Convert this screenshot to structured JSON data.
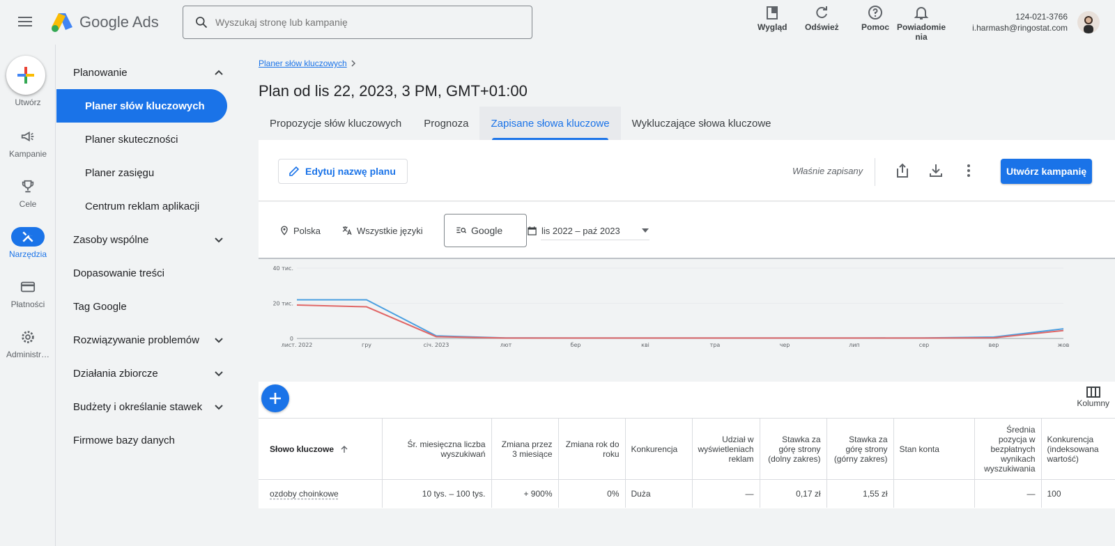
{
  "app": {
    "logo_google": "Google",
    "logo_ads": "Ads"
  },
  "search": {
    "placeholder": "Wyszukaj stronę lub kampanię"
  },
  "top_actions": {
    "appearance": "Wygląd",
    "refresh": "Odśwież",
    "help": "Pomoc",
    "notifications_line1": "Powiadomie",
    "notifications_line2": "nia"
  },
  "account": {
    "id": "124-021-3766",
    "email": "i.harmash@ringostat.com"
  },
  "rail": {
    "create": "Utwórz",
    "campaigns": "Kampanie",
    "goals": "Cele",
    "tools": "Narzędzia",
    "billing": "Płatności",
    "admin": "Administr…"
  },
  "sidebar": {
    "planning": "Planowanie",
    "keyword_planner": "Planer słów kluczowych",
    "performance_planner": "Planer skuteczności",
    "reach_planner": "Planer zasięgu",
    "app_ads_center": "Centrum reklam aplikacji",
    "shared_library": "Zasoby wspólne",
    "content_suitability": "Dopasowanie treści",
    "google_tag": "Tag Google",
    "troubleshooting": "Rozwiązywanie problemów",
    "bulk_actions": "Działania zbiorcze",
    "budgets_bidding": "Budżety i określanie stawek",
    "business_data": "Firmowe bazy danych"
  },
  "breadcrumb": "Planer słów kluczowych",
  "page_title": "Plan od lis 22, 2023, 3 PM, GMT+01:00",
  "tabs": {
    "ideas": "Propozycje słów kluczowych",
    "forecast": "Prognoza",
    "saved": "Zapisane słowa kluczowe",
    "negative": "Wykluczające słowa kluczowe"
  },
  "toolbar": {
    "edit_plan_name": "Edytuj nazwę planu",
    "saved_status": "Właśnie zapisany",
    "create_campaign": "Utwórz kampanię"
  },
  "filters": {
    "location": "Polska",
    "language": "Wszystkie języki",
    "network": "Google",
    "date_range": "lis 2022 – paź 2023"
  },
  "chart_data": {
    "type": "line",
    "x": [
      "лист. 2022",
      "гру",
      "січ. 2023",
      "лют",
      "бер",
      "кві",
      "тра",
      "чер",
      "лип",
      "сер",
      "вер",
      "жов"
    ],
    "yticks": [
      "0",
      "20 тис.",
      "40 тис."
    ],
    "ylim": [
      0,
      40000
    ],
    "series": [
      {
        "color": "#4a9fe0",
        "values": [
          22000,
          22000,
          1500,
          300,
          250,
          250,
          250,
          250,
          250,
          300,
          800,
          5500
        ]
      },
      {
        "color": "#e06666",
        "values": [
          19000,
          18000,
          1000,
          250,
          250,
          250,
          250,
          250,
          250,
          250,
          400,
          4500
        ]
      }
    ],
    "grid": true
  },
  "table": {
    "columns_label": "Kolumny",
    "headers": {
      "keyword": "Słowo kluczowe",
      "avg_searches": "Śr. miesięczna liczba wyszukiwań",
      "change_3m": "Zmiana przez 3 miesiące",
      "change_yoy": "Zmiana rok do roku",
      "competition": "Konkurencja",
      "impression_share": "Udział w wyświetleniach reklam",
      "bid_low": "Stawka za górę strony (dolny zakres)",
      "bid_high": "Stawka za górę strony (górny zakres)",
      "account_status": "Stan konta",
      "organic_position": "Średnia pozycja w bezpłatnych wynikach wyszukiwania",
      "competition_index": "Konkurencja (indeksowana wartość)"
    },
    "rows": [
      {
        "keyword": "ozdoby choinkowe",
        "avg_searches": "10 tys. – 100 tys.",
        "change_3m": "+ 900%",
        "change_yoy": "0%",
        "competition": "Duża",
        "impression_share": "—",
        "bid_low": "0,17 zł",
        "bid_high": "1,55 zł",
        "account_status": "",
        "organic_position": "—",
        "competition_index": "100"
      }
    ]
  },
  "colors": {
    "accent": "#1a73e8",
    "series_blue": "#4a9fe0",
    "series_red": "#e06666"
  }
}
